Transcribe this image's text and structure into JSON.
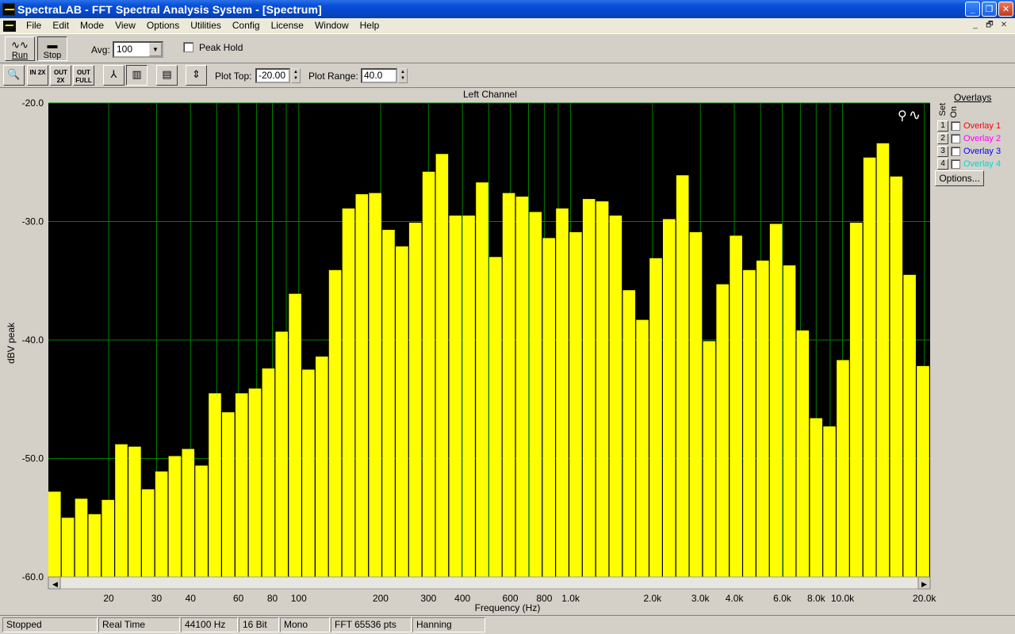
{
  "window": {
    "title": "SpectraLAB - FFT Spectral Analysis System - [Spectrum]",
    "buttons": {
      "minimize": "_",
      "maximize": "❐",
      "close": "✕"
    }
  },
  "menu": {
    "items": [
      "File",
      "Edit",
      "Mode",
      "View",
      "Options",
      "Utilities",
      "Config",
      "License",
      "Window",
      "Help"
    ],
    "mdi_buttons": {
      "minimize": "_",
      "restore": "🗗",
      "close": "✕"
    }
  },
  "toolbar": {
    "run_label": "Run",
    "stop_label": "Stop",
    "avg_label": "Avg:",
    "avg_value": "100",
    "peak_hold_label": "Peak Hold",
    "plot_top_label": "Plot Top:",
    "plot_top_value": "-20.00",
    "plot_range_label": "Plot Range:",
    "plot_range_value": "40.0",
    "zoom_buttons": [
      "IN 2X",
      "OUT 2X",
      "OUT FULL"
    ]
  },
  "overlays": {
    "title": "Overlays",
    "set_label": "Set",
    "on_label": "On",
    "options_label": "Options...",
    "items": [
      {
        "num": "1",
        "label": "Overlay 1",
        "color": "#ff0000"
      },
      {
        "num": "2",
        "label": "Overlay 2",
        "color": "#ff00ff"
      },
      {
        "num": "3",
        "label": "Overlay 3",
        "color": "#0000ff"
      },
      {
        "num": "4",
        "label": "Overlay 4",
        "color": "#00e0e0"
      }
    ]
  },
  "status": {
    "state": "Stopped",
    "mode": "Real Time",
    "rate": "44100 Hz",
    "bits": "16 Bit",
    "channels": "Mono",
    "fft": "FFT 65536 pts",
    "window": "Hanning"
  },
  "chart_data": {
    "type": "bar",
    "title": "Left Channel",
    "xlabel": "Frequency (Hz)",
    "ylabel": "dBV peak",
    "x_scale": "log",
    "xlim": [
      12,
      21000
    ],
    "ylim": [
      -60,
      -20
    ],
    "grid": true,
    "background": "#000000",
    "bar_color": "#ffff00",
    "grid_color": "#008000",
    "y_ticks": [
      "-20.0",
      "-30.0",
      "-40.0",
      "-50.0",
      "-60.0"
    ],
    "x_ticks": [
      {
        "v": 20,
        "label": "20"
      },
      {
        "v": 30,
        "label": "30"
      },
      {
        "v": 40,
        "label": "40"
      },
      {
        "v": 60,
        "label": "60"
      },
      {
        "v": 80,
        "label": "80"
      },
      {
        "v": 100,
        "label": "100"
      },
      {
        "v": 200,
        "label": "200"
      },
      {
        "v": 300,
        "label": "300"
      },
      {
        "v": 400,
        "label": "400"
      },
      {
        "v": 600,
        "label": "600"
      },
      {
        "v": 800,
        "label": "800"
      },
      {
        "v": 1000,
        "label": "1.0k"
      },
      {
        "v": 2000,
        "label": "2.0k"
      },
      {
        "v": 3000,
        "label": "3.0k"
      },
      {
        "v": 4000,
        "label": "4.0k"
      },
      {
        "v": 6000,
        "label": "6.0k"
      },
      {
        "v": 8000,
        "label": "8.0k"
      },
      {
        "v": 10000,
        "label": "10.0k"
      },
      {
        "v": 20000,
        "label": "20.0k"
      }
    ],
    "grid_x": [
      20,
      30,
      40,
      50,
      60,
      70,
      80,
      90,
      100,
      200,
      300,
      400,
      500,
      600,
      700,
      800,
      900,
      1000,
      2000,
      3000,
      4000,
      5000,
      6000,
      7000,
      8000,
      9000,
      10000,
      20000
    ],
    "series": [
      {
        "values": [
          -52.8,
          -55.0,
          -53.4,
          -54.7,
          -53.5,
          -48.8,
          -49.0,
          -52.6,
          -51.1,
          -49.8,
          -49.2,
          -50.6,
          -44.5,
          -46.1,
          -44.5,
          -44.1,
          -42.4,
          -39.3,
          -36.1,
          -42.5,
          -41.4,
          -34.1,
          -28.9,
          -27.7,
          -27.6,
          -30.7,
          -32.1,
          -30.1,
          -25.8,
          -24.3,
          -29.5,
          -29.5,
          -26.7,
          -33.0,
          -27.6,
          -27.9,
          -29.2,
          -31.4,
          -28.9,
          -30.9,
          -28.1,
          -28.3,
          -29.5,
          -35.8,
          -38.3,
          -33.1,
          -29.8,
          -26.1,
          -30.9,
          -40.1,
          -35.3,
          -31.2,
          -34.1,
          -33.3,
          -30.2,
          -33.7,
          -39.2,
          -46.6,
          -47.3,
          -41.7,
          -30.1,
          -24.6,
          -23.4,
          -26.2,
          -34.5,
          -42.2
        ]
      }
    ]
  }
}
